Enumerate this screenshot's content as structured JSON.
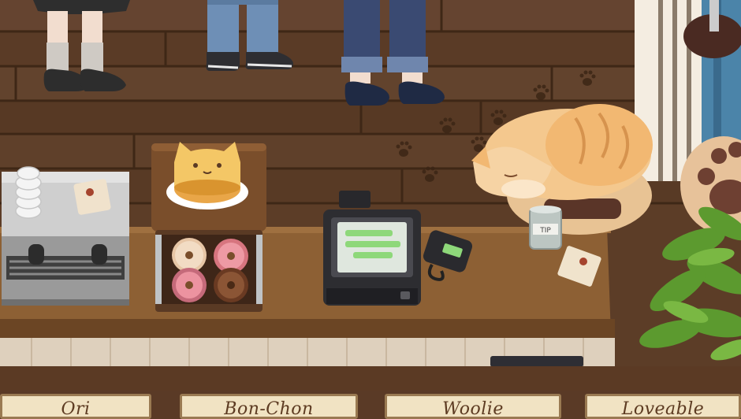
{
  "customer_tags": [
    {
      "label": "Ori"
    },
    {
      "label": "Bon-Chon"
    },
    {
      "label": "Woolie"
    },
    {
      "label": "Loveable"
    }
  ],
  "counter_items": {
    "tip_jar_label": "TIP"
  },
  "icons": [
    "espresso-machine-icon",
    "cat-cake-icon",
    "donut-display-icon",
    "cash-register-icon",
    "card-reader-icon",
    "sleeping-cat-icon",
    "tip-jar-icon",
    "plant-icon"
  ],
  "colors": {
    "floor": "#5c3d27",
    "counter": "#8d6034",
    "tag_bg": "#f1e3c3",
    "tag_text": "#5d3b22",
    "register_screen": "#8ed87a"
  }
}
